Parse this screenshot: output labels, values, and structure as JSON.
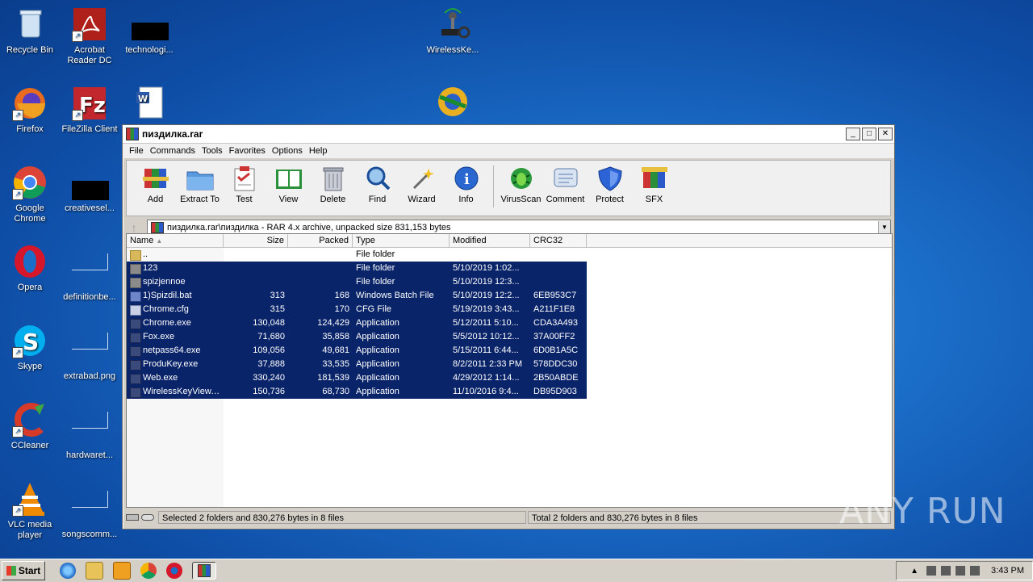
{
  "desktop": {
    "icons": [
      {
        "label": "Recycle Bin"
      },
      {
        "label": "Acrobat Reader DC"
      },
      {
        "label": "technologi..."
      },
      {
        "label": "WirelessKe..."
      },
      {
        "label": "Firefox"
      },
      {
        "label": "FileZilla Client"
      },
      {
        "label": "Google Chrome"
      },
      {
        "label": "creativesel..."
      },
      {
        "label": "Opera"
      },
      {
        "label": "definitionbe..."
      },
      {
        "label": "Skype"
      },
      {
        "label": "extrabad.png"
      },
      {
        "label": "CCleaner"
      },
      {
        "label": "hardwaret..."
      },
      {
        "label": "VLC media player"
      },
      {
        "label": "songscomm..."
      }
    ]
  },
  "window": {
    "title": "пиздилка.rar",
    "menu": [
      "File",
      "Commands",
      "Tools",
      "Favorites",
      "Options",
      "Help"
    ],
    "toolbar": [
      "Add",
      "Extract To",
      "Test",
      "View",
      "Delete",
      "Find",
      "Wizard",
      "Info",
      "VirusScan",
      "Comment",
      "Protect",
      "SFX"
    ],
    "address": "пиздилка.rar\\пиздилка - RAR 4.x archive, unpacked size 831,153 bytes",
    "columns": [
      "Name",
      "Size",
      "Packed",
      "Type",
      "Modified",
      "CRC32"
    ],
    "rows": [
      {
        "name": "..",
        "size": "",
        "packed": "",
        "type": "File folder",
        "modified": "",
        "crc": ""
      },
      {
        "name": "123",
        "size": "",
        "packed": "",
        "type": "File folder",
        "modified": "5/10/2019 1:02...",
        "crc": ""
      },
      {
        "name": "spizjennoe",
        "size": "",
        "packed": "",
        "type": "File folder",
        "modified": "5/10/2019 12:3...",
        "crc": ""
      },
      {
        "name": "1)Spizdil.bat",
        "size": "313",
        "packed": "168",
        "type": "Windows Batch File",
        "modified": "5/10/2019 12:2...",
        "crc": "6EB953C7"
      },
      {
        "name": "Chrome.cfg",
        "size": "315",
        "packed": "170",
        "type": "CFG File",
        "modified": "5/19/2019 3:43...",
        "crc": "A211F1E8"
      },
      {
        "name": "Chrome.exe",
        "size": "130,048",
        "packed": "124,429",
        "type": "Application",
        "modified": "5/12/2011 5:10...",
        "crc": "CDA3A493"
      },
      {
        "name": "Fox.exe",
        "size": "71,680",
        "packed": "35,858",
        "type": "Application",
        "modified": "5/5/2012 10:12...",
        "crc": "37A00FF2"
      },
      {
        "name": "netpass64.exe",
        "size": "109,056",
        "packed": "49,681",
        "type": "Application",
        "modified": "5/15/2011 6:44...",
        "crc": "6D0B1A5C"
      },
      {
        "name": "ProduKey.exe",
        "size": "37,888",
        "packed": "33,535",
        "type": "Application",
        "modified": "8/2/2011 2:33 PM",
        "crc": "578DDC30"
      },
      {
        "name": "Web.exe",
        "size": "330,240",
        "packed": "181,539",
        "type": "Application",
        "modified": "4/29/2012 1:14...",
        "crc": "2B50ABDE"
      },
      {
        "name": "WirelessKeyView....",
        "size": "150,736",
        "packed": "68,730",
        "type": "Application",
        "modified": "11/10/2016 9:4...",
        "crc": "DB95D903"
      }
    ],
    "status_left": "Selected 2 folders and 830,276 bytes in 8 files",
    "status_right": "Total 2 folders and 830,276 bytes in 8 files"
  },
  "taskbar": {
    "start": "Start",
    "clock": "3:43 PM"
  },
  "watermark": "ANY RUN"
}
